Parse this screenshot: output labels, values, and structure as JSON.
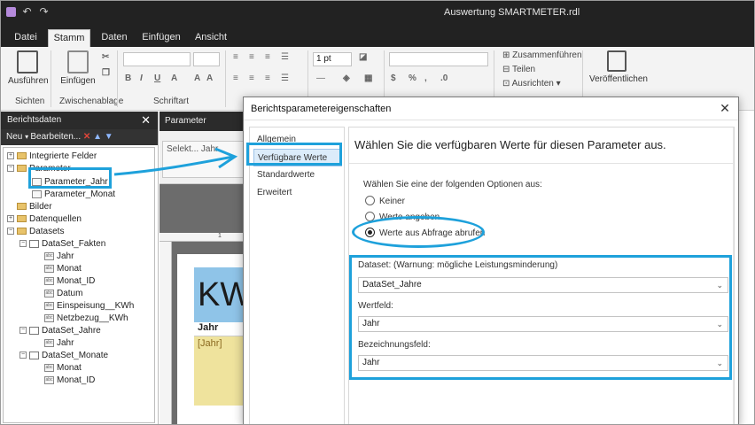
{
  "app": {
    "title": "Auswertung SMARTMETER.rdl"
  },
  "ribbon_tabs": [
    "Datei",
    "Stamm",
    "Daten",
    "Einfügen",
    "Ansicht"
  ],
  "ribbon": {
    "run_label": "Ausführen",
    "paste_label": "Einfügen",
    "font_size": "1 pt",
    "merge_label": "Zusammenführen",
    "split_label": "Teilen",
    "align_label": "Ausrichten",
    "publish_label": "Veröffentlichen",
    "groups": {
      "views": "Sichten",
      "clipboard": "Zwischenablage",
      "font": "Schriftart"
    }
  },
  "left_pane": {
    "title": "Berichtsdaten",
    "new_label": "Neu",
    "edit_label": "Bearbeiten...",
    "tree": [
      {
        "label": "Integrierte Felder"
      },
      {
        "label": "Parameter"
      },
      {
        "label": "Parameter_Jahr"
      },
      {
        "label": "Parameter_Monat"
      },
      {
        "label": "Bilder"
      },
      {
        "label": "Datenquellen"
      },
      {
        "label": "Datasets"
      },
      {
        "label": "DataSet_Fakten"
      },
      {
        "label": "Jahr"
      },
      {
        "label": "Monat"
      },
      {
        "label": "Monat_ID"
      },
      {
        "label": "Datum"
      },
      {
        "label": "Einspeisung__KWh"
      },
      {
        "label": "Netzbezug__KWh"
      },
      {
        "label": "DataSet_Jahre"
      },
      {
        "label": "Jahr"
      },
      {
        "label": "DataSet_Monate"
      },
      {
        "label": "Monat"
      },
      {
        "label": "Monat_ID"
      }
    ]
  },
  "middle": {
    "param_header": "Parameter",
    "select_text": "Selekt... Jahr",
    "ruler_mark": "1",
    "kw_text": "KW",
    "col_header": "Jahr",
    "col_value": "[Jahr]"
  },
  "dialog": {
    "title": "Berichtsparametereigenschaften",
    "nav": [
      "Allgemein",
      "Verfügbare Werte",
      "Standardwerte",
      "Erweitert"
    ],
    "heading": "Wählen Sie die verfügbaren Werte für diesen Parameter aus.",
    "options_label": "Wählen Sie eine der folgenden Optionen aus:",
    "options": [
      "Keiner",
      "Werte angeben",
      "Werte aus Abfrage abrufen"
    ],
    "dataset_label": "Dataset: (Warnung: mögliche Leistungsminderung)",
    "dataset_value": "DataSet_Jahre",
    "value_field_label": "Wertfeld:",
    "value_field_value": "Jahr",
    "label_field_label": "Bezeichnungsfeld:",
    "label_field_value": "Jahr"
  },
  "colors": {
    "highlight": "#1ea1db",
    "titlebar": "#222222",
    "kw_fill": "#8fc4e8",
    "col_fill": "#efe39d"
  }
}
